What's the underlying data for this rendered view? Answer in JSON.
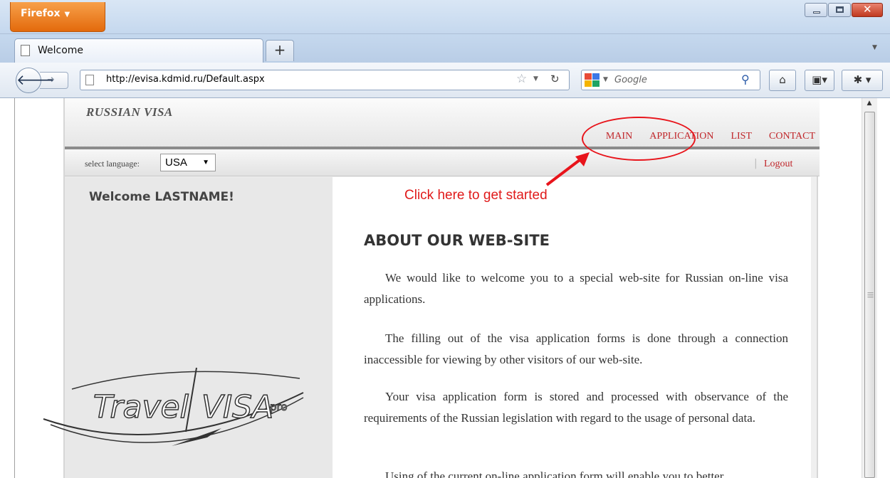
{
  "browser": {
    "app_button": "Firefox",
    "tab_title": "Welcome",
    "new_tab": "+",
    "url": "http://evisa.kdmid.ru/Default.aspx",
    "search_placeholder": "Google"
  },
  "site": {
    "logo": "RUSSIAN VISA",
    "nav": {
      "main": "MAIN",
      "application": "APPLICATION",
      "list": "LIST",
      "contact": "CONTACT"
    },
    "language_label": "select language:",
    "language_value": "USA",
    "logout_separator": "|",
    "logout": "Logout",
    "welcome": "Welcome LASTNAME!",
    "heading": "ABOUT OUR WEB-SITE",
    "paragraphs": [
      "We would like to welcome you to a special web-site for Russian on-line visa applications.",
      "The filling out of the visa application forms is done through a connection inaccessible for viewing by other visitors of our web-site.",
      "Your visa application form is stored and processed with observance of the requirements of the Russian legislation with regard to the usage of personal data.",
      "Using of the current on-line application form will enable you to better"
    ]
  },
  "annotation": {
    "text": "Click here to get started",
    "color": "#e8141b"
  },
  "watermark": {
    "word1": "Travel",
    "word2": "VISA",
    "word3": "pro"
  },
  "colors": {
    "nav_link": "#c0262a",
    "firefox_orange": "#e36a0c"
  }
}
